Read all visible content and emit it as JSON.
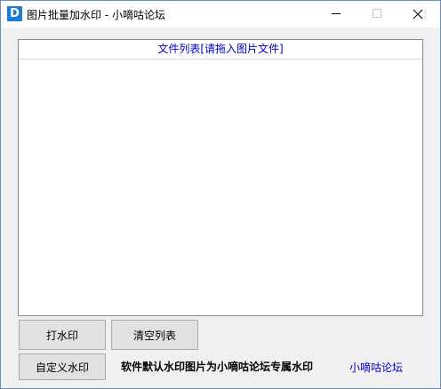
{
  "window": {
    "icon_letter": "D",
    "title": "图片批量加水印 - 小嘀咕论坛",
    "controls": {
      "minimize": "minimize-icon",
      "maximize": "maximize-icon",
      "close": "close-icon"
    }
  },
  "file_list": {
    "header": "文件列表[请拖入图片文件]",
    "items": []
  },
  "buttons": {
    "watermark_label": "打水印",
    "clear_label": "清空列表",
    "custom_label": "自定义水印"
  },
  "footer": {
    "note": "软件默认水印图片为小嘀咕论坛专属水印",
    "link_label": "小嘀咕论坛"
  },
  "colors": {
    "accent_blue": "#0000cc",
    "app_icon_bg": "#1e7ad6"
  }
}
